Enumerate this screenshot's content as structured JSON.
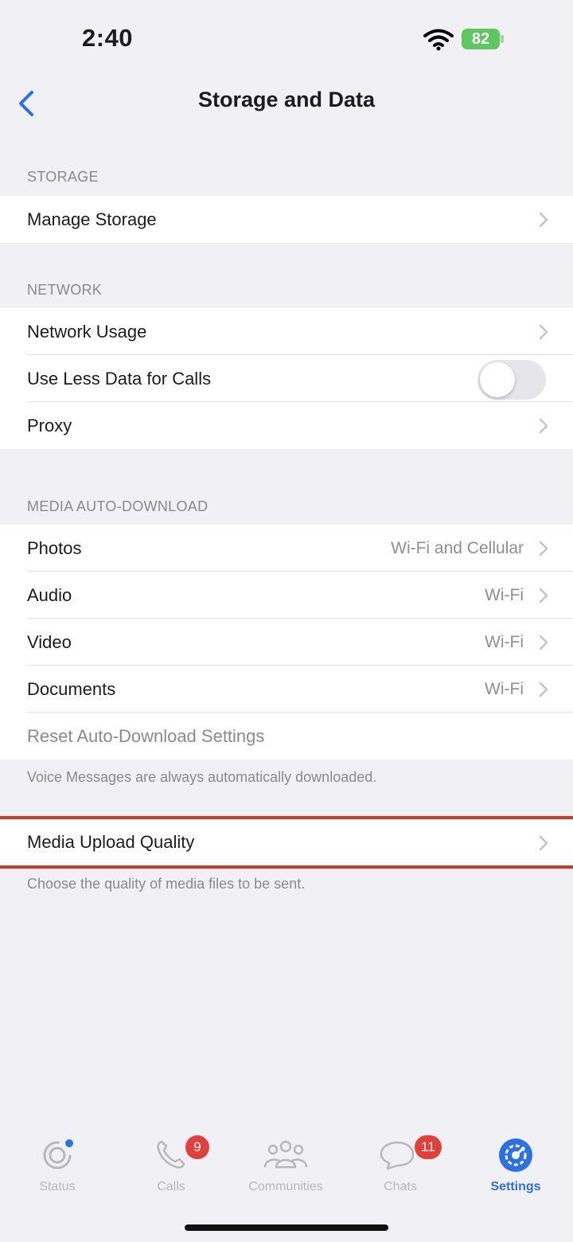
{
  "status_bar": {
    "time": "2:40",
    "battery": "82",
    "icons": [
      "wifi-icon",
      "battery-icon"
    ]
  },
  "nav": {
    "title": "Storage and Data",
    "back_icon": "chevron-left-icon"
  },
  "sections": {
    "storage": {
      "header": "STORAGE",
      "rows": [
        {
          "label": "Manage Storage"
        }
      ]
    },
    "network": {
      "header": "NETWORK",
      "rows": [
        {
          "label": "Network Usage"
        },
        {
          "label": "Use Less Data for Calls",
          "toggle": "off"
        },
        {
          "label": "Proxy"
        }
      ]
    },
    "media_auto_download": {
      "header": "MEDIA AUTO-DOWNLOAD",
      "rows": [
        {
          "label": "Photos",
          "value": "Wi-Fi and Cellular"
        },
        {
          "label": "Audio",
          "value": "Wi-Fi"
        },
        {
          "label": "Video",
          "value": "Wi-Fi"
        },
        {
          "label": "Documents",
          "value": "Wi-Fi"
        },
        {
          "label": "Reset Auto-Download Settings"
        }
      ],
      "footer": "Voice Messages are always automatically downloaded."
    },
    "media_upload": {
      "rows": [
        {
          "label": "Media Upload Quality"
        }
      ],
      "footer": "Choose the quality of media files to be sent."
    }
  },
  "tab_bar": {
    "tabs": [
      {
        "label": "Status",
        "icon": "status-icon"
      },
      {
        "label": "Calls",
        "icon": "phone-icon",
        "badge": "9"
      },
      {
        "label": "Communities",
        "icon": "communities-icon"
      },
      {
        "label": "Chats",
        "icon": "chat-bubbles-icon",
        "badge": "11"
      },
      {
        "label": "Settings",
        "icon": "settings-gear-icon",
        "active": true
      }
    ]
  },
  "colors": {
    "accent": "#2a70e8",
    "badge": "#e1413a",
    "highlight": "#cc3a24",
    "battery": "#5fc75f"
  }
}
